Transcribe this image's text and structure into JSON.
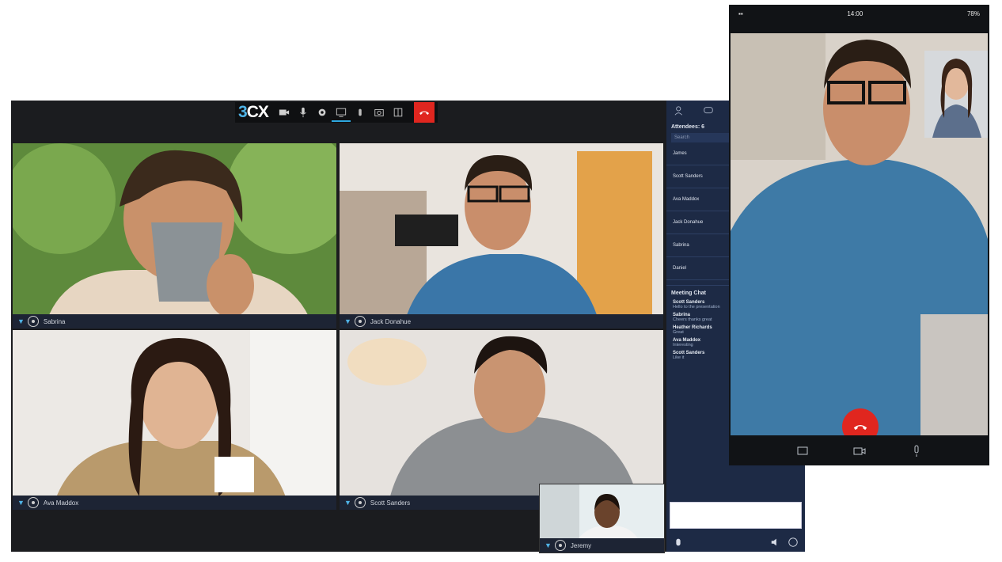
{
  "app": {
    "logo": "3CX",
    "logo_prefix": "3",
    "logo_suffix": "CX",
    "accent": "#2ea8e0",
    "hangup_color": "#e0261f"
  },
  "toolbar": {
    "icons": [
      "video-icon",
      "microphone-icon",
      "settings-icon",
      "screen-share-icon",
      "raise-hand-icon",
      "camera-switch-icon",
      "whiteboard-icon",
      "hangup-icon"
    ]
  },
  "tiles": [
    {
      "name": "Sabrina"
    },
    {
      "name": "Jack Donahue"
    },
    {
      "name": "Ava Maddox"
    },
    {
      "name": "Scott Sanders"
    },
    {
      "name": "Jeremy"
    }
  ],
  "sidebar": {
    "attendees_title": "Attendees: 6",
    "search_placeholder": "Search",
    "attendees": [
      "James",
      "Scott Sanders",
      "Ava Maddox",
      "Jack Donahue",
      "Sabrina",
      "Daniel"
    ],
    "chat_title": "Meeting Chat",
    "messages": [
      {
        "author": "Scott Sanders",
        "text": "Hello to the presentation"
      },
      {
        "author": "Sabrina",
        "text": "Cheers thanks great"
      },
      {
        "author": "Heather Richards",
        "text": "Great"
      },
      {
        "author": "Ava Maddox",
        "text": "Interesting"
      },
      {
        "author": "Scott Sanders",
        "text": "Like it"
      }
    ]
  },
  "phone": {
    "time": "14:00",
    "battery": "78%"
  }
}
